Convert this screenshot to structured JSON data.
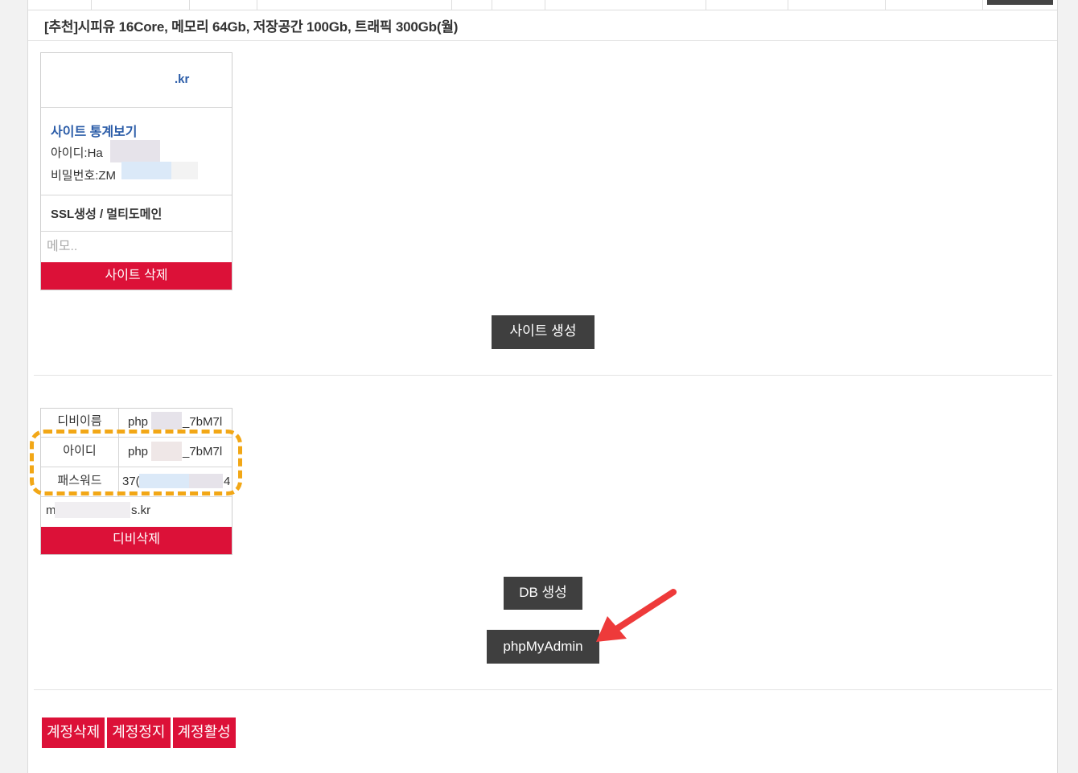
{
  "plan_title": "[추천]시피유 16Core, 메모리 64Gb, 저장공간 100Gb, 트래픽 300Gb(월)",
  "site": {
    "domain": ".kr",
    "stats_link": "사이트 통계보기",
    "id_line": "아이디:Ha",
    "pw_line": "비밀번호:ZM",
    "ssl_link": "SSL생성 / 멀티도메인",
    "memo_placeholder": "메모..",
    "delete_button": "사이트 삭제"
  },
  "create_site_button": "사이트 생성",
  "db": {
    "rows": [
      {
        "label": "디비이름",
        "value_prefix": "php",
        "value_suffix": "_7bM7l"
      },
      {
        "label": "아이디",
        "value_prefix": "php",
        "value_suffix": "_7bM7l"
      },
      {
        "label": "패스워드",
        "value_prefix": "37(",
        "value_suffix": "4"
      }
    ],
    "host_prefix": "m",
    "host_suffix": "s.kr",
    "delete_button": "디비삭제"
  },
  "create_db_button": "DB 생성",
  "phpmyadmin_button": "phpMyAdmin",
  "account_buttons": {
    "delete": "계정삭제",
    "suspend": "계정정지",
    "activate": "계정활성"
  },
  "colors": {
    "danger": "#dc1138",
    "dark": "#3f3f3f",
    "link": "#2b5ca8",
    "highlight": "#f2a716",
    "arrow": "#ee3a3a"
  }
}
